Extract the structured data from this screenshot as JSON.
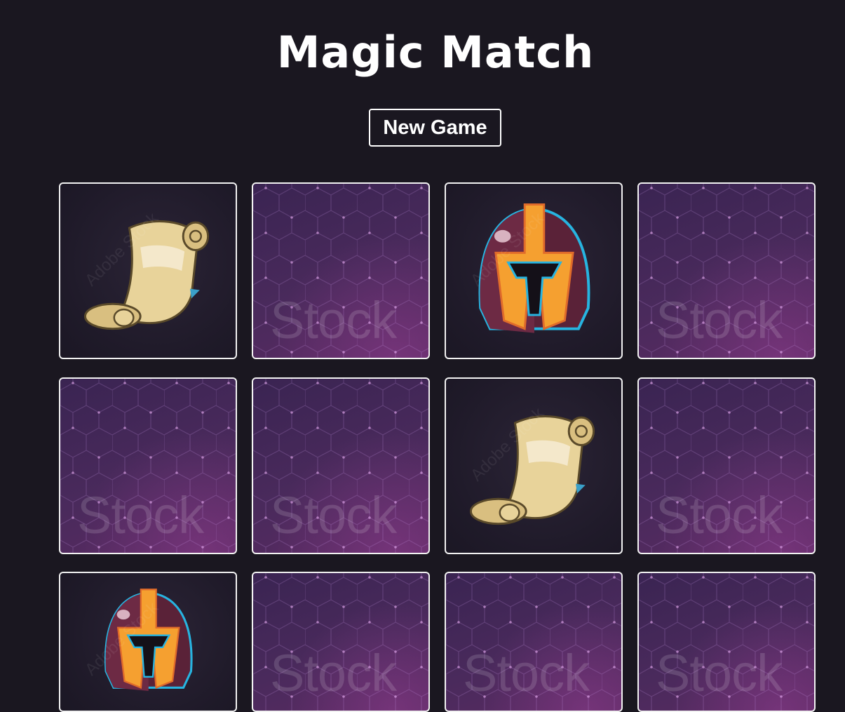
{
  "game": {
    "title": "Magic Match",
    "new_game_label": "New Game",
    "card_back_watermark": "Stock",
    "face_up_watermark": "Adobe Stock"
  },
  "cards": [
    {
      "state": "face-up",
      "symbol": "scroll"
    },
    {
      "state": "face-down"
    },
    {
      "state": "face-up",
      "symbol": "helmet"
    },
    {
      "state": "face-down"
    },
    {
      "state": "face-down"
    },
    {
      "state": "face-down"
    },
    {
      "state": "face-up",
      "symbol": "scroll"
    },
    {
      "state": "face-down"
    },
    {
      "state": "face-up",
      "symbol": "helmet"
    },
    {
      "state": "face-down"
    },
    {
      "state": "face-down"
    },
    {
      "state": "face-down"
    }
  ],
  "colors": {
    "background": "#1a1720",
    "card_border": "#f2f2f2",
    "card_back": "#4a2a5c",
    "text": "#ffffff"
  }
}
